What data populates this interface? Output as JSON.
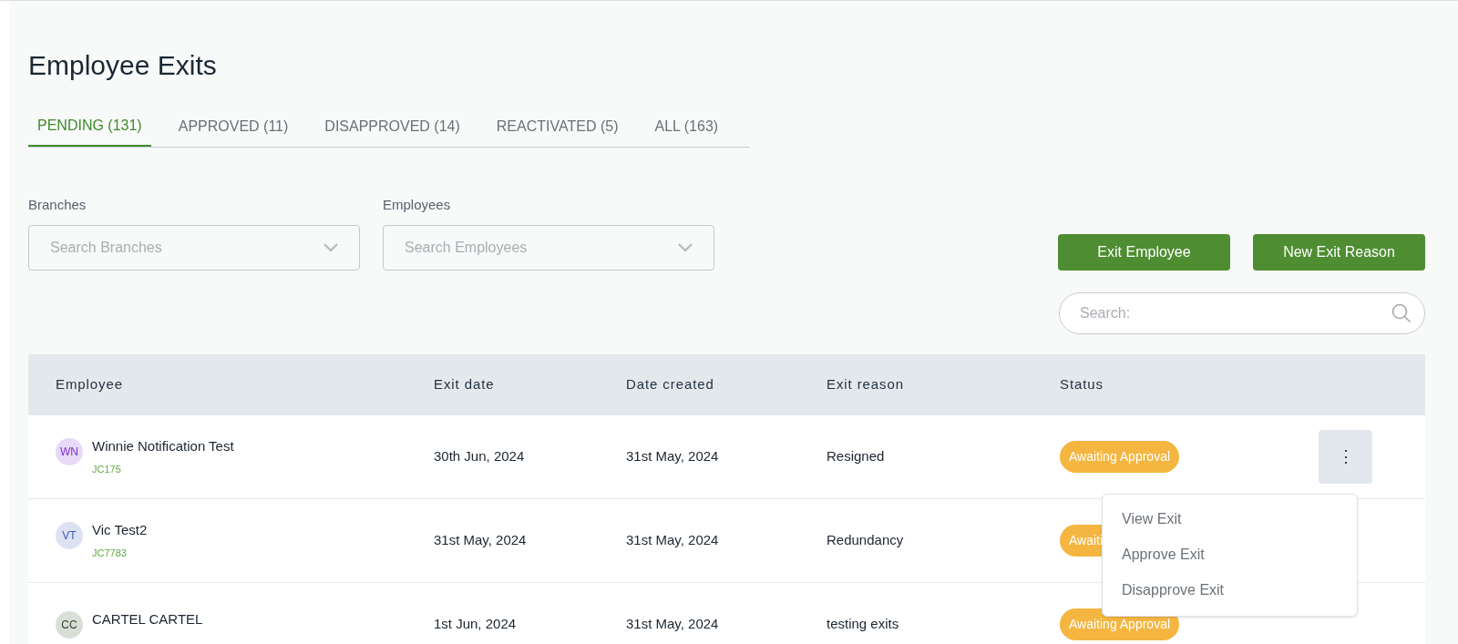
{
  "page": {
    "title": "Employee Exits"
  },
  "tabs": [
    {
      "label": "PENDING (131)",
      "selected": true
    },
    {
      "label": "APPROVED (11)",
      "selected": false
    },
    {
      "label": "DISAPPROVED (14)",
      "selected": false
    },
    {
      "label": "REACTIVATED (5)",
      "selected": false
    },
    {
      "label": "ALL (163)",
      "selected": false
    }
  ],
  "filters": [
    {
      "label": "Branches",
      "placeholder": "Search Branches"
    },
    {
      "label": "Employees",
      "placeholder": "Search Employees"
    }
  ],
  "buttons": [
    "Exit Employee",
    "New Exit Reason"
  ],
  "search": {
    "placeholder": "Search:"
  },
  "table": {
    "columns": [
      "Employee",
      "Exit date",
      "Date created",
      "Exit reason",
      "Status"
    ],
    "rows": [
      {
        "initials": "WN",
        "color": "#7a2fd0",
        "name": "Winnie Notification Test",
        "code": "JC175",
        "exit_date": "30th Jun, 2024",
        "date_created": "31st May, 2024",
        "exit_reason": "Resigned",
        "status": "Awaiting Approval",
        "actions": "⋮"
      },
      {
        "initials": "VT",
        "color": "#3d5cb8",
        "name": "Vic Test2",
        "code": "JC7783",
        "exit_date": "31st May, 2024",
        "date_created": "31st May, 2024",
        "exit_reason": "Redundancy",
        "status": "Awaiti"
      },
      {
        "initials": "CC",
        "color": "#2b4a22",
        "name": "CARTEL CARTEL",
        "exit_date": "1st Jun, 2024",
        "date_created": "31st May, 2024",
        "exit_reason": "testing exits",
        "status": "Awaiting Approval"
      }
    ]
  },
  "row_menu": {
    "items": [
      "View Exit",
      "Approve Exit",
      "Disapprove Exit"
    ]
  }
}
